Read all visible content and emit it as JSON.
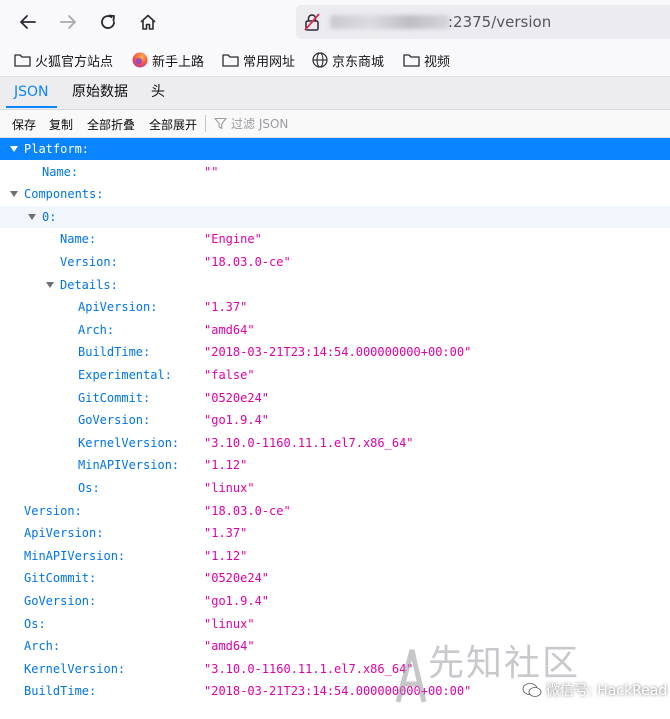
{
  "browser": {
    "url_visible": ":2375/version",
    "bookmarks": [
      "火狐官方站点",
      "新手上路",
      "常用网址",
      "京东商城",
      "视频"
    ]
  },
  "viewer": {
    "tabs": [
      "JSON",
      "原始数据",
      "头"
    ],
    "active_tab": "JSON",
    "toolbar": {
      "save": "保存",
      "copy": "复制",
      "collapse_all": "全部折叠",
      "expand_all": "全部展开",
      "filter_placeholder": "过滤 JSON"
    }
  },
  "tree": [
    {
      "key": "Platform:",
      "value": "",
      "depth": 0,
      "twisty": true,
      "selected": true
    },
    {
      "key": "Name:",
      "value": "\"\"",
      "depth": 1
    },
    {
      "key": "Components:",
      "value": "",
      "depth": 0,
      "twisty": true
    },
    {
      "key": "0:",
      "value": "",
      "depth": 1,
      "twisty": true,
      "highlight": true
    },
    {
      "key": "Name:",
      "value": "\"Engine\"",
      "depth": 2
    },
    {
      "key": "Version:",
      "value": "\"18.03.0-ce\"",
      "depth": 2
    },
    {
      "key": "Details:",
      "value": "",
      "depth": 2,
      "twisty": true
    },
    {
      "key": "ApiVersion:",
      "value": "\"1.37\"",
      "depth": 3
    },
    {
      "key": "Arch:",
      "value": "\"amd64\"",
      "depth": 3
    },
    {
      "key": "BuildTime:",
      "value": "\"2018-03-21T23:14:54.000000000+00:00\"",
      "depth": 3
    },
    {
      "key": "Experimental:",
      "value": "\"false\"",
      "depth": 3
    },
    {
      "key": "GitCommit:",
      "value": "\"0520e24\"",
      "depth": 3
    },
    {
      "key": "GoVersion:",
      "value": "\"go1.9.4\"",
      "depth": 3
    },
    {
      "key": "KernelVersion:",
      "value": "\"3.10.0-1160.11.1.el7.x86_64\"",
      "depth": 3
    },
    {
      "key": "MinAPIVersion:",
      "value": "\"1.12\"",
      "depth": 3
    },
    {
      "key": "Os:",
      "value": "\"linux\"",
      "depth": 3
    },
    {
      "key": "Version:",
      "value": "\"18.03.0-ce\"",
      "depth": 0
    },
    {
      "key": "ApiVersion:",
      "value": "\"1.37\"",
      "depth": 0
    },
    {
      "key": "MinAPIVersion:",
      "value": "\"1.12\"",
      "depth": 0
    },
    {
      "key": "GitCommit:",
      "value": "\"0520e24\"",
      "depth": 0
    },
    {
      "key": "GoVersion:",
      "value": "\"go1.9.4\"",
      "depth": 0
    },
    {
      "key": "Os:",
      "value": "\"linux\"",
      "depth": 0
    },
    {
      "key": "Arch:",
      "value": "\"amd64\"",
      "depth": 0
    },
    {
      "key": "KernelVersion:",
      "value": "\"3.10.0-1160.11.1.el7.x86_64\"",
      "depth": 0
    },
    {
      "key": "BuildTime:",
      "value": "\"2018-03-21T23:14:54.000000000+00:00\"",
      "depth": 0
    }
  ],
  "watermark": {
    "site": "先知社区",
    "wechat": "微信号: HackRead"
  },
  "colors": {
    "accent": "#0a84ff",
    "key": "#0074e8",
    "string": "#dd00a9"
  },
  "icons": [
    "back-arrow-icon",
    "forward-arrow-icon",
    "reload-icon",
    "home-icon",
    "lock-icon",
    "folder-icon",
    "firefox-icon",
    "globe-icon",
    "filter-icon"
  ]
}
